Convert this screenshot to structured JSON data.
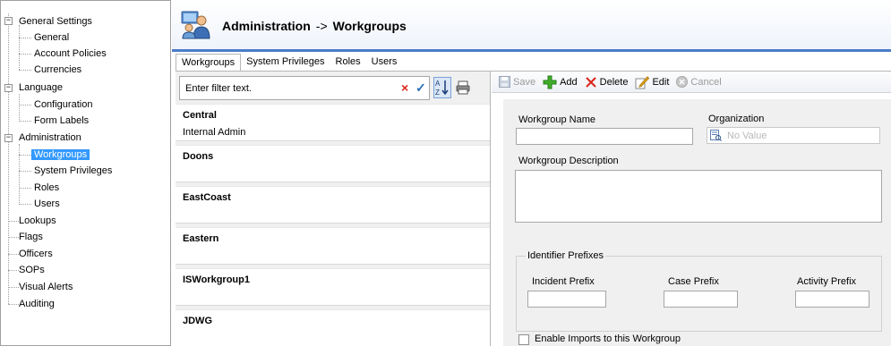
{
  "tree": {
    "nodes": [
      {
        "label": "General Settings",
        "expander": "−"
      },
      {
        "label": "General"
      },
      {
        "label": "Account Policies"
      },
      {
        "label": "Currencies"
      },
      {
        "label": "Language",
        "expander": "−"
      },
      {
        "label": "Configuration"
      },
      {
        "label": "Form Labels"
      },
      {
        "label": "Administration",
        "expander": "−"
      },
      {
        "label": "Workgroups",
        "selected": true
      },
      {
        "label": "System Privileges"
      },
      {
        "label": "Roles"
      },
      {
        "label": "Users"
      },
      {
        "label": "Lookups"
      },
      {
        "label": "Flags"
      },
      {
        "label": "Officers"
      },
      {
        "label": "SOPs"
      },
      {
        "label": "Visual Alerts"
      },
      {
        "label": "Auditing"
      }
    ]
  },
  "header": {
    "section": "Administration",
    "arrow": "->",
    "page": "Workgroups",
    "icon": "users-group-icon"
  },
  "tabs": [
    {
      "label": "Workgroups",
      "active": true
    },
    {
      "label": "System Privileges"
    },
    {
      "label": "Roles"
    },
    {
      "label": "Users"
    }
  ],
  "filter": {
    "text": "Enter filter text.",
    "clear_icon": "×",
    "apply_icon": "✓"
  },
  "workgroups": [
    {
      "name": "Central",
      "sub": "Internal Admin"
    },
    {
      "name": "Doons",
      "sub": ""
    },
    {
      "name": "EastCoast",
      "sub": ""
    },
    {
      "name": "Eastern",
      "sub": ""
    },
    {
      "name": "ISWorkgroup1",
      "sub": ""
    },
    {
      "name": "JDWG",
      "sub": ""
    }
  ],
  "toolbar": {
    "save": "Save",
    "add": "Add",
    "delete": "Delete",
    "edit": "Edit",
    "cancel": "Cancel"
  },
  "form": {
    "name_label": "Workgroup Name",
    "name_value": "",
    "org_label": "Organization",
    "org_placeholder": "No Value",
    "desc_label": "Workgroup Description",
    "desc_value": "",
    "prefix_group": "Identifier Prefixes",
    "incident_label": "Incident Prefix",
    "case_label": "Case Prefix",
    "activity_label": "Activity Prefix",
    "enable_label": "Enable Imports to this Workgroup",
    "enable_checked": false
  },
  "colors": {
    "selection": "#3399ff",
    "header_rule": "#4a7cc9",
    "delete_red": "#d9241c",
    "add_green": "#3fae2a"
  }
}
